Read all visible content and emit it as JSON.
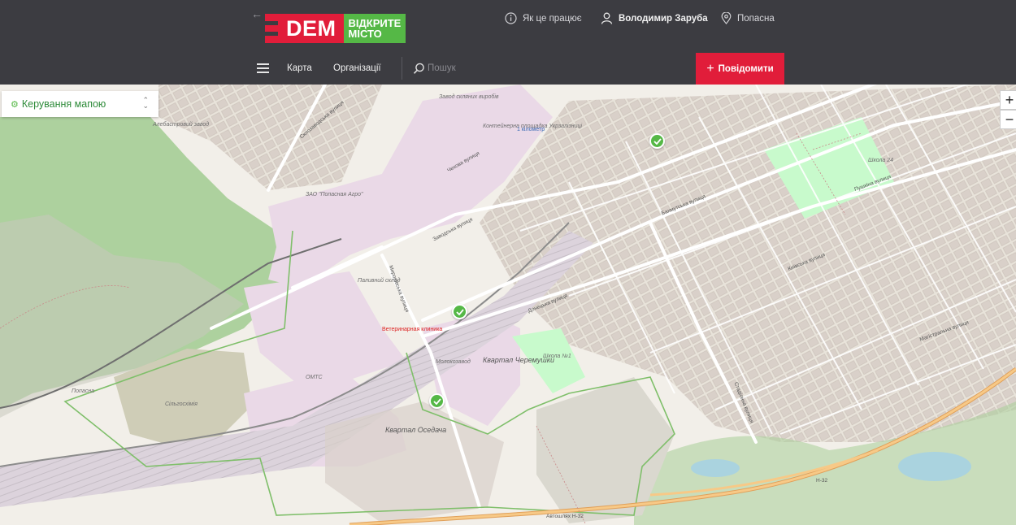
{
  "header": {
    "back_arrow": "←",
    "logo_main": "DEM",
    "logo_line1": "ВІДКРИТЕ",
    "logo_line2": "МІСТО",
    "how_it_works": "Як це працює",
    "user_name": "Володимир Заруба",
    "city": "Попасна",
    "nav_map": "Карта",
    "nav_orgs": "Організації",
    "search_placeholder": "Пошук",
    "report_button": "Повідомити",
    "colors": {
      "bg": "#3c3c41",
      "red": "#e11d3a",
      "green": "#55b846"
    }
  },
  "map": {
    "control_panel_label": "Керування мапою",
    "zoom_in": "+",
    "zoom_out": "−",
    "labels": {
      "glass_factory": "Завод скляних виробів",
      "alabaster": "Алебастровий завод",
      "container_area": "Контейнерна площадка Укрзалізниці",
      "km1": "1 кілометр",
      "popasna_agro": "ЗАО \"Попасная Агро\"",
      "fuel_store": "Паливний склад",
      "vet_clinic": "Ветеринарная клиника",
      "omts": "ОМТС",
      "silgosphimia": "Сільгосхімія",
      "milk_plant": "Молокозавод",
      "kvartal_cheremushky": "Квартал Черемушки",
      "school1": "Школа №1",
      "kvartal_osedacha": "Квартал Оседача",
      "school24": "Школа 24",
      "popasna_river": "Попасна",
      "highway_h32": "Автошлях Н-32",
      "h32": "Н-32",
      "street_bakhmutska": "Бахмутська вулиця",
      "street_pushkina": "Пушкіна вулиця",
      "street_kyivska": "Київська вулиця",
      "street_sklozavodska": "Склозаводська вулиця",
      "street_chekhova": "Чехова вулиця",
      "street_zavodska": "Заводська вулиця",
      "street_donetska": "Донецька вулиця",
      "street_magistralna": "Магістральна вулиця",
      "street_myronivska": "Миронівська вулиця",
      "street_stadionna": "Стадіонна вулиця"
    }
  }
}
